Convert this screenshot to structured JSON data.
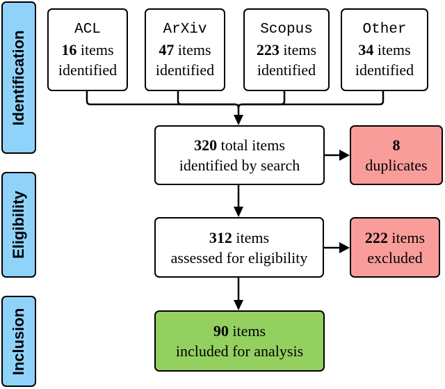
{
  "stages": [
    {
      "label": "Identification"
    },
    {
      "label": "Eligibility"
    },
    {
      "label": "Inclusion"
    }
  ],
  "sources": [
    {
      "name": "ACL",
      "count": "16",
      "unit": " items",
      "status": "identified"
    },
    {
      "name": "ArXiv",
      "count": "47",
      "unit": " items",
      "status": "identified"
    },
    {
      "name": "Scopus",
      "count": "223",
      "unit": " items",
      "status": "identified"
    },
    {
      "name": "Other",
      "count": "34",
      "unit": " items",
      "status": "identified"
    }
  ],
  "total": {
    "count": "320",
    "line1": " total items",
    "line2": "identified by search"
  },
  "duplicates": {
    "count": "8",
    "line2": "duplicates"
  },
  "eligibility": {
    "count": "312",
    "line1": " items",
    "line2": "assessed for eligibility"
  },
  "excluded": {
    "count": "222",
    "line1": " items",
    "line2": "excluded"
  },
  "included": {
    "count": "90",
    "line1": " items",
    "line2": "included for analysis"
  },
  "colors": {
    "stage": "#8fd3fb",
    "removed": "#f99d9b",
    "included": "#94d060"
  }
}
